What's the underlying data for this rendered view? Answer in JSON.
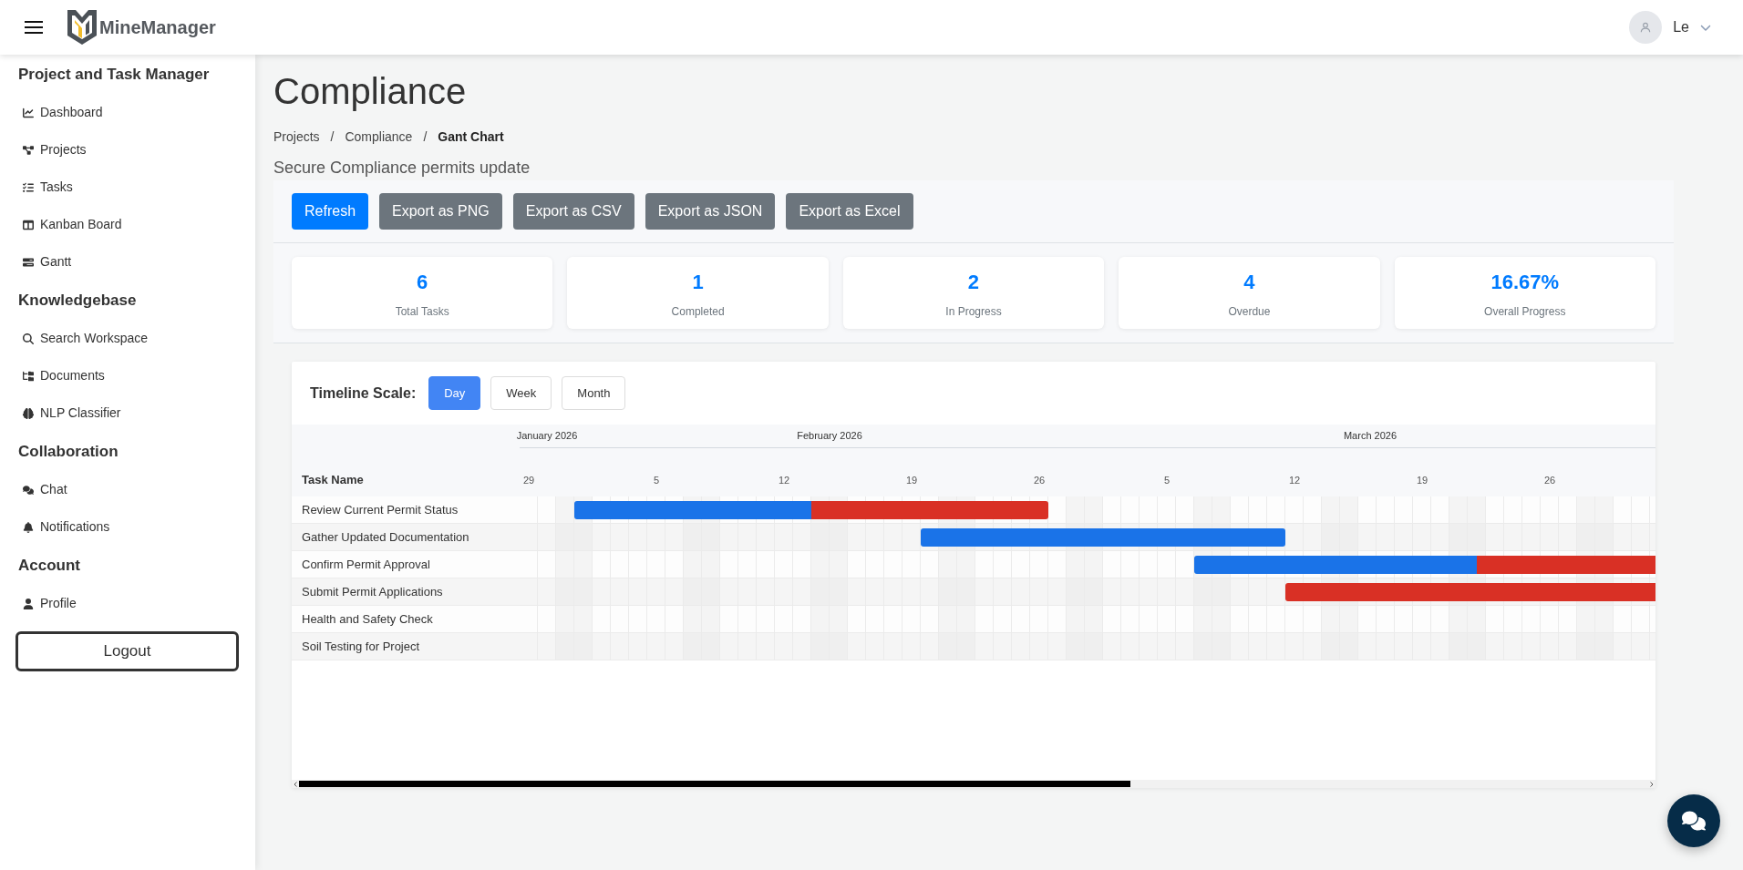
{
  "header": {
    "brand": "MineManager",
    "user": {
      "name": "Le"
    }
  },
  "sidebar": {
    "sections": [
      {
        "title": "Project and Task Manager",
        "items": [
          {
            "label": "Dashboard"
          },
          {
            "label": "Projects"
          },
          {
            "label": "Tasks"
          },
          {
            "label": "Kanban Board"
          },
          {
            "label": "Gantt"
          }
        ]
      },
      {
        "title": "Knowledgebase",
        "items": [
          {
            "label": "Search Workspace"
          },
          {
            "label": "Documents"
          },
          {
            "label": "NLP Classifier"
          }
        ]
      },
      {
        "title": "Collaboration",
        "items": [
          {
            "label": "Chat"
          },
          {
            "label": "Notifications"
          }
        ]
      },
      {
        "title": "Account",
        "items": [
          {
            "label": "Profile"
          }
        ]
      }
    ],
    "logout": "Logout"
  },
  "page": {
    "title": "Compliance",
    "breadcrumb": [
      {
        "label": "Projects",
        "current": false
      },
      {
        "separator": "/",
        "label": "Compliance",
        "current": false
      },
      {
        "separator": "/",
        "label": "Gant Chart",
        "current": true
      }
    ],
    "subtitle": "Secure Compliance permits update"
  },
  "toolbar": {
    "buttons": [
      {
        "label": "Refresh",
        "kind": "primary"
      },
      {
        "label": "Export as PNG",
        "kind": "secondary"
      },
      {
        "label": "Export as CSV",
        "kind": "secondary"
      },
      {
        "label": "Export as JSON",
        "kind": "secondary"
      },
      {
        "label": "Export as Excel",
        "kind": "secondary"
      }
    ]
  },
  "stats": [
    {
      "value": "6",
      "label": "Total Tasks"
    },
    {
      "value": "1",
      "label": "Completed"
    },
    {
      "value": "2",
      "label": "In Progress"
    },
    {
      "value": "4",
      "label": "Overdue"
    },
    {
      "value": "16.67%",
      "label": "Overall Progress"
    }
  ],
  "gantt": {
    "scale_label": "Timeline Scale:",
    "scales": [
      {
        "label": "Day",
        "selected": true
      },
      {
        "label": "Week",
        "selected": false
      },
      {
        "label": "Month",
        "selected": false
      }
    ],
    "task_column": "Task Name",
    "months": [
      "January 2026",
      "February 2026",
      "March 2026"
    ],
    "day_labels": [
      "29",
      "5",
      "12",
      "19",
      "26",
      "5",
      "12",
      "19",
      "26"
    ],
    "tasks": [
      {
        "name": "Review Current Permit Status",
        "segments": [
          {
            "color": "#1a73e8"
          },
          {
            "color": "#d93025"
          }
        ]
      },
      {
        "name": "Gather Updated Documentation",
        "segments": [
          {
            "color": "#1a73e8"
          }
        ]
      },
      {
        "name": "Confirm Permit Approval",
        "segments": [
          {
            "color": "#1a73e8"
          },
          {
            "color": "#d93025"
          }
        ]
      },
      {
        "name": "Submit Permit Applications",
        "segments": [
          {
            "color": "#d93025"
          }
        ]
      },
      {
        "name": "Health and Safety Check"
      },
      {
        "name": "Soil Testing for Project"
      }
    ]
  }
}
